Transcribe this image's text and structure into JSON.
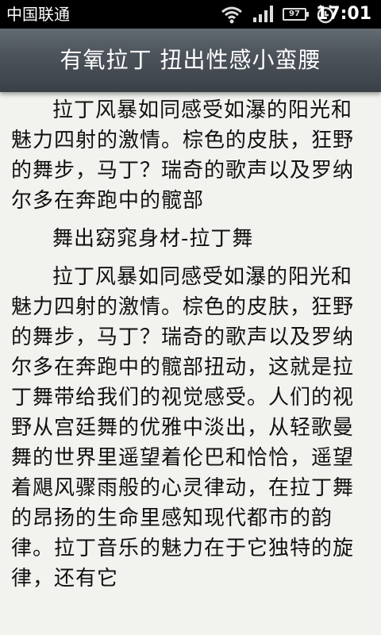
{
  "status_bar": {
    "carrier": "中国联通",
    "battery_level": "97",
    "time": "17:01"
  },
  "header": {
    "title": "有氧拉丁 扭出性感小蛮腰"
  },
  "article": {
    "paragraphs": [
      "拉丁风暴如同感受如瀑的阳光和魅力四射的激情。棕色的皮肤，狂野的舞步，马丁？瑞奇的歌声以及罗纳尔多在奔跑中的髋部",
      "舞出窈窕身材-拉丁舞",
      "拉丁风暴如同感受如瀑的阳光和魅力四射的激情。棕色的皮肤，狂野的舞步，马丁？瑞奇的歌声以及罗纳尔多在奔跑中的髋部扭动，这就是拉丁舞带给我们的视觉感受。人们的视野从宫廷舞的优雅中淡出，从轻歌曼舞的世界里遥望着伦巴和恰恰，遥望着飓风骤雨般的心灵律动，在拉丁舞的昂扬的生命里感知现代都市的韵律。拉丁音乐的魅力在于它独特的旋律，还有它"
    ]
  }
}
